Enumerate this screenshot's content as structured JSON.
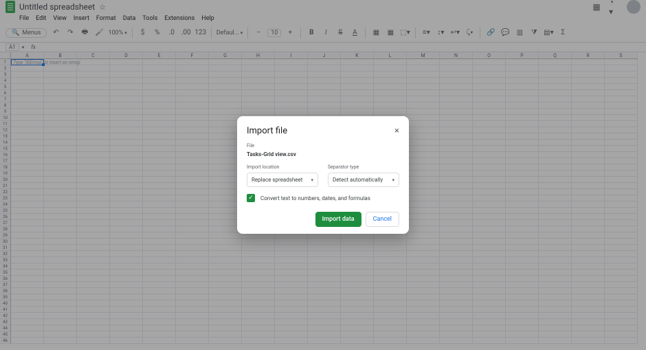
{
  "header": {
    "title": "Untitled spreadsheet"
  },
  "menu": {
    "file": "File",
    "edit": "Edit",
    "view": "View",
    "insert": "Insert",
    "format": "Format",
    "data": "Data",
    "tools": "Tools",
    "ext": "Extensions",
    "help": "Help"
  },
  "toolbar": {
    "menus": "Menus",
    "zoom": "100%",
    "font": "Defaul...",
    "fontsize": "10",
    "currency": "$",
    "percent": "%"
  },
  "namebox": {
    "cell": "A1",
    "fx": "fx"
  },
  "grid": {
    "cols": [
      "A",
      "B",
      "C",
      "D",
      "E",
      "F",
      "G",
      "H",
      "I",
      "J",
      "K",
      "L",
      "M",
      "N",
      "O",
      "P",
      "Q",
      "R",
      "S"
    ],
    "rows_count": 46,
    "hint": "Type \"@Emoji\" to insert an emoji"
  },
  "dialog": {
    "title": "Import file",
    "file_label": "File",
    "file_name": "Tasks-Grid view.csv",
    "loc_label": "Import location",
    "loc_value": "Replace spreadsheet",
    "sep_label": "Separator type",
    "sep_value": "Detect automatically",
    "convert_label": "Convert text to numbers, dates, and formulas",
    "import_btn": "Import data",
    "cancel_btn": "Cancel"
  }
}
